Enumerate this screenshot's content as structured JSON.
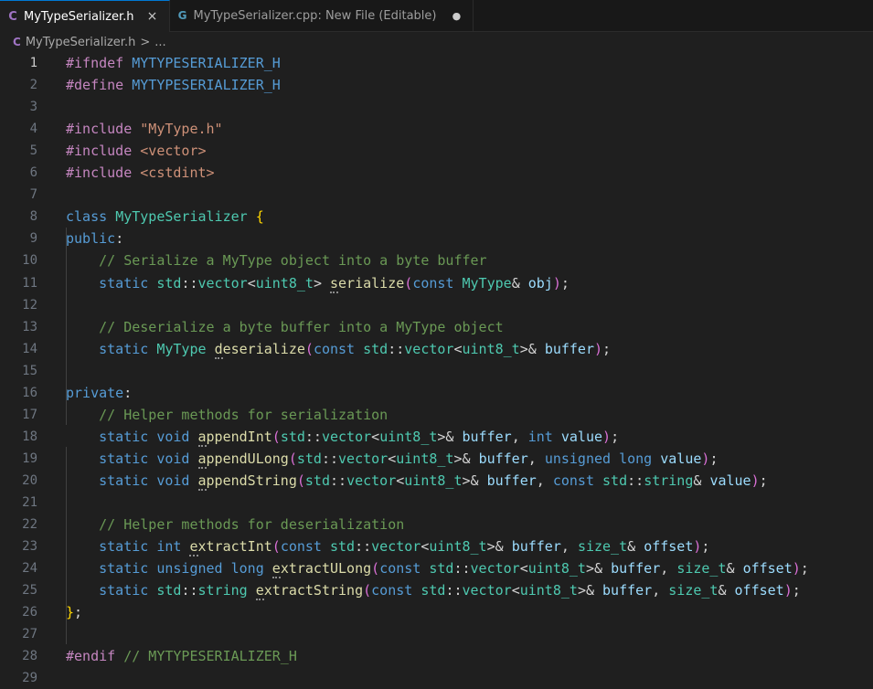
{
  "tabs": [
    {
      "lang_icon": "C",
      "label": "MyTypeSerializer.h",
      "active": true,
      "action": "×"
    },
    {
      "lang_icon": "G",
      "label": "MyTypeSerializer.cpp: New File (Editable)",
      "active": false,
      "action": "●"
    }
  ],
  "breadcrumb": {
    "lang_icon": "C",
    "file": "MyTypeSerializer.h",
    "separator": ">",
    "rest": "..."
  },
  "current_line": 1,
  "lines": [
    [
      [
        "pre",
        "#ifndef "
      ],
      [
        "mac",
        "MYTYPESERIALIZER_H"
      ]
    ],
    [
      [
        "pre",
        "#define "
      ],
      [
        "mac",
        "MYTYPESERIALIZER_H"
      ]
    ],
    [],
    [
      [
        "pre",
        "#include "
      ],
      [
        "str",
        "\"MyType.h\""
      ]
    ],
    [
      [
        "pre",
        "#include "
      ],
      [
        "str",
        "<vector>"
      ]
    ],
    [
      [
        "pre",
        "#include "
      ],
      [
        "str",
        "<cstdint>"
      ]
    ],
    [],
    [
      [
        "kw",
        "class "
      ],
      [
        "type",
        "MyTypeSerializer"
      ],
      [
        "pl",
        " "
      ],
      [
        "br",
        "{"
      ]
    ],
    [
      [
        "kw",
        "public"
      ],
      [
        "pl",
        ":"
      ]
    ],
    [
      [
        "pl",
        "    "
      ],
      [
        "com",
        "// Serialize a MyType object into a byte buffer"
      ]
    ],
    [
      [
        "pl",
        "    "
      ],
      [
        "kw",
        "static "
      ],
      [
        "type",
        "std"
      ],
      [
        "pl",
        "::"
      ],
      [
        "type",
        "vector"
      ],
      [
        "pl",
        "<"
      ],
      [
        "type",
        "uint8_t"
      ],
      [
        "pl",
        "> "
      ],
      [
        "fnsq",
        "serialize"
      ],
      [
        "br2",
        "("
      ],
      [
        "kw",
        "const "
      ],
      [
        "type",
        "MyType"
      ],
      [
        "pl",
        "& "
      ],
      [
        "var",
        "obj"
      ],
      [
        "br2",
        ")"
      ],
      [
        "pl",
        ";"
      ]
    ],
    [],
    [
      [
        "pl",
        "    "
      ],
      [
        "com",
        "// Deserialize a byte buffer into a MyType object"
      ]
    ],
    [
      [
        "pl",
        "    "
      ],
      [
        "kw",
        "static "
      ],
      [
        "type",
        "MyType "
      ],
      [
        "fnsq",
        "deserialize"
      ],
      [
        "br2",
        "("
      ],
      [
        "kw",
        "const "
      ],
      [
        "type",
        "std"
      ],
      [
        "pl",
        "::"
      ],
      [
        "type",
        "vector"
      ],
      [
        "pl",
        "<"
      ],
      [
        "type",
        "uint8_t"
      ],
      [
        "pl",
        ">& "
      ],
      [
        "var",
        "buffer"
      ],
      [
        "br2",
        ")"
      ],
      [
        "pl",
        ";"
      ]
    ],
    [],
    [
      [
        "kw",
        "private"
      ],
      [
        "pl",
        ":"
      ]
    ],
    [
      [
        "pl",
        "    "
      ],
      [
        "com",
        "// Helper methods for serialization"
      ]
    ],
    [
      [
        "pl",
        "    "
      ],
      [
        "kw",
        "static void "
      ],
      [
        "fnsq",
        "appendInt"
      ],
      [
        "br2",
        "("
      ],
      [
        "type",
        "std"
      ],
      [
        "pl",
        "::"
      ],
      [
        "type",
        "vector"
      ],
      [
        "pl",
        "<"
      ],
      [
        "type",
        "uint8_t"
      ],
      [
        "pl",
        ">& "
      ],
      [
        "var",
        "buffer"
      ],
      [
        "pl",
        ", "
      ],
      [
        "kw",
        "int "
      ],
      [
        "var",
        "value"
      ],
      [
        "br2",
        ")"
      ],
      [
        "pl",
        ";"
      ]
    ],
    [
      [
        "pl",
        "    "
      ],
      [
        "kw",
        "static void "
      ],
      [
        "fnsq",
        "appendULong"
      ],
      [
        "br2",
        "("
      ],
      [
        "type",
        "std"
      ],
      [
        "pl",
        "::"
      ],
      [
        "type",
        "vector"
      ],
      [
        "pl",
        "<"
      ],
      [
        "type",
        "uint8_t"
      ],
      [
        "pl",
        ">& "
      ],
      [
        "var",
        "buffer"
      ],
      [
        "pl",
        ", "
      ],
      [
        "kw",
        "unsigned long "
      ],
      [
        "var",
        "value"
      ],
      [
        "br2",
        ")"
      ],
      [
        "pl",
        ";"
      ]
    ],
    [
      [
        "pl",
        "    "
      ],
      [
        "kw",
        "static void "
      ],
      [
        "fnsq",
        "appendString"
      ],
      [
        "br2",
        "("
      ],
      [
        "type",
        "std"
      ],
      [
        "pl",
        "::"
      ],
      [
        "type",
        "vector"
      ],
      [
        "pl",
        "<"
      ],
      [
        "type",
        "uint8_t"
      ],
      [
        "pl",
        ">& "
      ],
      [
        "var",
        "buffer"
      ],
      [
        "pl",
        ", "
      ],
      [
        "kw",
        "const "
      ],
      [
        "type",
        "std"
      ],
      [
        "pl",
        "::"
      ],
      [
        "type",
        "string"
      ],
      [
        "pl",
        "& "
      ],
      [
        "var",
        "value"
      ],
      [
        "br2",
        ")"
      ],
      [
        "pl",
        ";"
      ]
    ],
    [],
    [
      [
        "pl",
        "    "
      ],
      [
        "com",
        "// Helper methods for deserialization"
      ]
    ],
    [
      [
        "pl",
        "    "
      ],
      [
        "kw",
        "static int "
      ],
      [
        "fnsq",
        "extractInt"
      ],
      [
        "br2",
        "("
      ],
      [
        "kw",
        "const "
      ],
      [
        "type",
        "std"
      ],
      [
        "pl",
        "::"
      ],
      [
        "type",
        "vector"
      ],
      [
        "pl",
        "<"
      ],
      [
        "type",
        "uint8_t"
      ],
      [
        "pl",
        ">& "
      ],
      [
        "var",
        "buffer"
      ],
      [
        "pl",
        ", "
      ],
      [
        "type",
        "size_t"
      ],
      [
        "pl",
        "& "
      ],
      [
        "var",
        "offset"
      ],
      [
        "br2",
        ")"
      ],
      [
        "pl",
        ";"
      ]
    ],
    [
      [
        "pl",
        "    "
      ],
      [
        "kw",
        "static unsigned long "
      ],
      [
        "fnsq",
        "extractULong"
      ],
      [
        "br2",
        "("
      ],
      [
        "kw",
        "const "
      ],
      [
        "type",
        "std"
      ],
      [
        "pl",
        "::"
      ],
      [
        "type",
        "vector"
      ],
      [
        "pl",
        "<"
      ],
      [
        "type",
        "uint8_t"
      ],
      [
        "pl",
        ">& "
      ],
      [
        "var",
        "buffer"
      ],
      [
        "pl",
        ", "
      ],
      [
        "type",
        "size_t"
      ],
      [
        "pl",
        "& "
      ],
      [
        "var",
        "offset"
      ],
      [
        "br2",
        ")"
      ],
      [
        "pl",
        ";"
      ]
    ],
    [
      [
        "pl",
        "    "
      ],
      [
        "kw",
        "static "
      ],
      [
        "type",
        "std"
      ],
      [
        "pl",
        "::"
      ],
      [
        "type",
        "string "
      ],
      [
        "fnsq",
        "extractString"
      ],
      [
        "br2",
        "("
      ],
      [
        "kw",
        "const "
      ],
      [
        "type",
        "std"
      ],
      [
        "pl",
        "::"
      ],
      [
        "type",
        "vector"
      ],
      [
        "pl",
        "<"
      ],
      [
        "type",
        "uint8_t"
      ],
      [
        "pl",
        ">& "
      ],
      [
        "var",
        "buffer"
      ],
      [
        "pl",
        ", "
      ],
      [
        "type",
        "size_t"
      ],
      [
        "pl",
        "& "
      ],
      [
        "var",
        "offset"
      ],
      [
        "br2",
        ")"
      ],
      [
        "pl",
        ";"
      ]
    ],
    [
      [
        "br",
        "}"
      ],
      [
        "pl",
        ";"
      ]
    ],
    [],
    [
      [
        "pre",
        "#endif "
      ],
      [
        "com",
        "// MYTYPESERIALIZER_H"
      ]
    ],
    []
  ]
}
